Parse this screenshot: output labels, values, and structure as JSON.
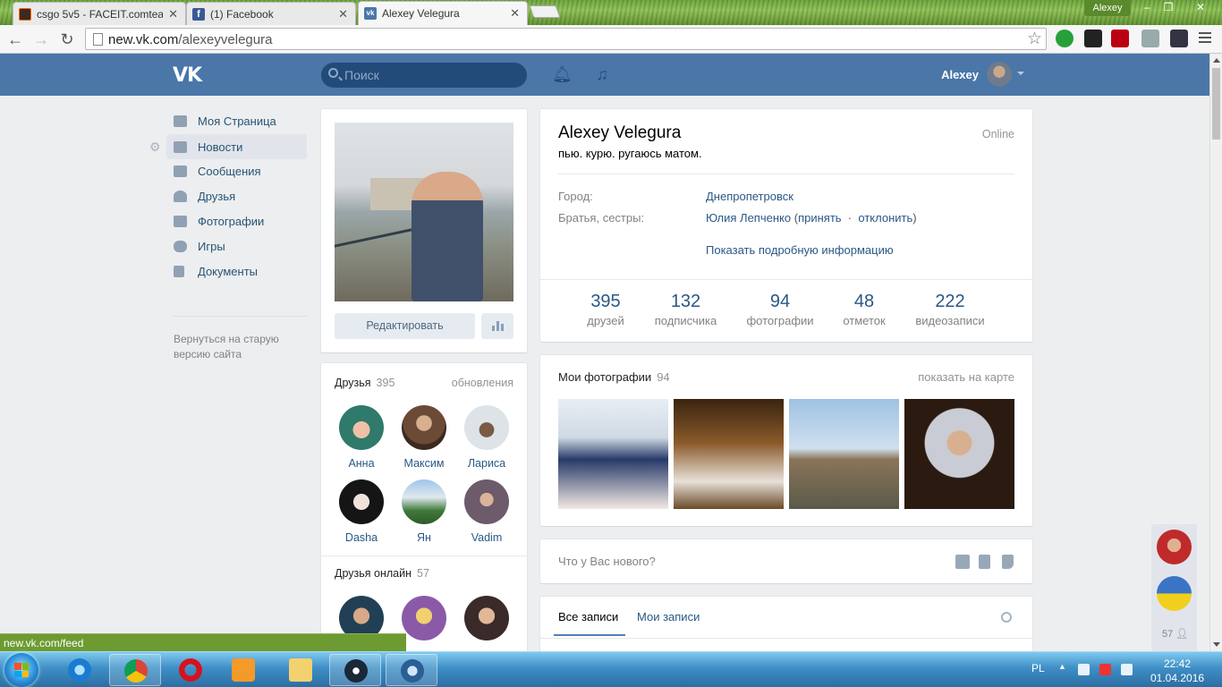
{
  "browser": {
    "tabs": [
      {
        "label": "csgo 5v5 - FACEIT.comtea",
        "active": false
      },
      {
        "label": "(1) Facebook",
        "active": false
      },
      {
        "label": "Alexey Velegura",
        "active": true
      }
    ],
    "window_user": "Alexey",
    "url_host": "new.vk.com",
    "url_path": "/alexeyvelegura",
    "status_url": "new.vk.com/feed"
  },
  "header": {
    "search_placeholder": "Поиск",
    "user_name": "Alexey",
    "brand_color": "#4a76a8"
  },
  "sidebar": {
    "items": [
      {
        "label": "Моя Страница",
        "icon": "home-icon"
      },
      {
        "label": "Новости",
        "icon": "news-icon",
        "active": true
      },
      {
        "label": "Сообщения",
        "icon": "messages-icon"
      },
      {
        "label": "Друзья",
        "icon": "friends-icon"
      },
      {
        "label": "Фотографии",
        "icon": "photos-icon"
      },
      {
        "label": "Игры",
        "icon": "games-icon"
      },
      {
        "label": "Документы",
        "icon": "documents-icon"
      }
    ],
    "old_version": "Вернуться на старую версию сайта"
  },
  "profile": {
    "name": "Alexey Velegura",
    "status": "пью. курю. ругаюсь матом.",
    "online": "Online",
    "edit_label": "Редактировать",
    "info": [
      {
        "label": "Город:",
        "value": "Днепропетровск"
      },
      {
        "label": "Братья, сестры:",
        "value": "Юлия Лепченко",
        "accept": "принять",
        "decline": "отклонить"
      }
    ],
    "more_info": "Показать подробную информацию",
    "counters": [
      {
        "num": "395",
        "label": "друзей"
      },
      {
        "num": "132",
        "label": "подписчика"
      },
      {
        "num": "94",
        "label": "фотографии"
      },
      {
        "num": "48",
        "label": "отметок"
      },
      {
        "num": "222",
        "label": "видеозаписи"
      }
    ]
  },
  "friends": {
    "title": "Друзья",
    "count": "395",
    "updates": "обновления",
    "list": [
      "Анна",
      "Максим",
      "Лариса",
      "Dasha",
      "Ян",
      "Vadim"
    ],
    "online_title": "Друзья онлайн",
    "online_count": "57"
  },
  "photos": {
    "title": "Мои фотографии",
    "count": "94",
    "map_link": "показать на карте"
  },
  "new_post": {
    "placeholder": "Что у Вас нового?"
  },
  "wall": {
    "tab_all": "Все записи",
    "tab_mine": "Мои записи"
  },
  "chat": {
    "online_count": "57"
  },
  "taskbar": {
    "lang": "PL",
    "time": "22:42",
    "date": "01.04.2016"
  }
}
